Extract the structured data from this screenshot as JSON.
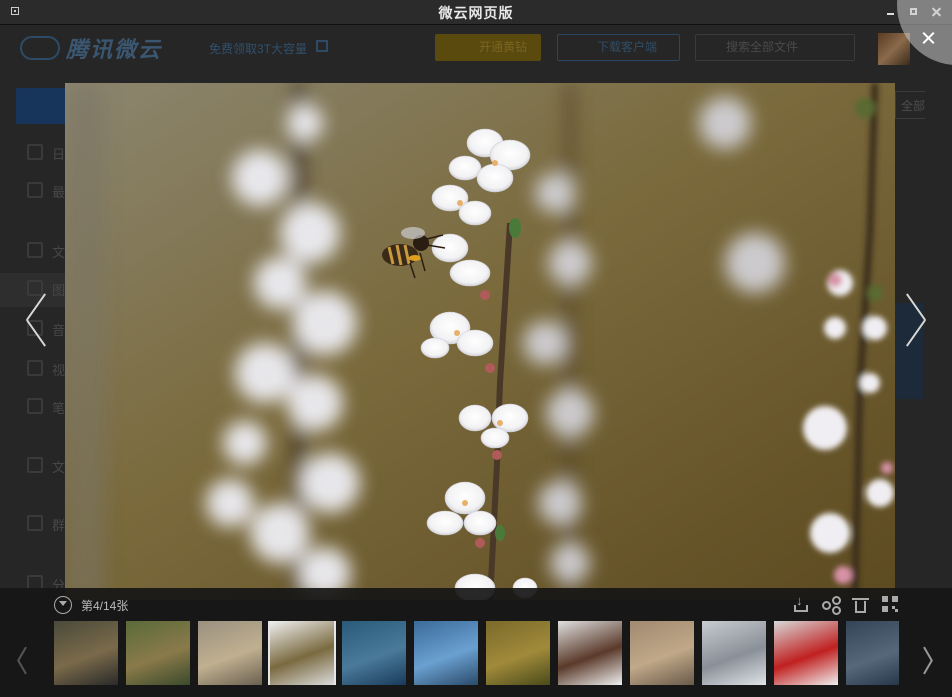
{
  "window": {
    "title": "微云网页版"
  },
  "background_app": {
    "logo_text": "腾讯微云",
    "promo": "免费领取3T大容量",
    "vip_button": "开通黄钻",
    "download_button": "下载客户端",
    "search_placeholder": "搜索全部文件",
    "all_filter": "全部",
    "sidebar_items": [
      {
        "label": "日",
        "icon": "doc-icon"
      },
      {
        "label": "最",
        "icon": "clock-icon"
      },
      {
        "label": "文",
        "icon": "file-icon"
      },
      {
        "label": "图",
        "icon": "image-icon"
      },
      {
        "label": "音",
        "icon": "music-icon"
      },
      {
        "label": "视",
        "icon": "video-icon"
      },
      {
        "label": "笔",
        "icon": "note-icon"
      },
      {
        "label": "文",
        "icon": "folder-icon"
      },
      {
        "label": "群",
        "icon": "group-icon"
      },
      {
        "label": "分",
        "icon": "share-icon"
      }
    ]
  },
  "viewer": {
    "counter": "第4/14张",
    "close_icon": "close-icon",
    "photo_subject": "bee-on-blossom-photo",
    "tools": [
      "download-icon",
      "share-icon",
      "delete-icon",
      "qrcode-icon"
    ],
    "thumbnails": [
      {
        "name": "thumb-1",
        "colors": [
          "#4a4a3a",
          "#7a6a4a",
          "#2a2a2a"
        ]
      },
      {
        "name": "thumb-2",
        "colors": [
          "#5a6a3a",
          "#8a7a4a",
          "#3a4a2a"
        ]
      },
      {
        "name": "thumb-3",
        "colors": [
          "#9a9080",
          "#c0b090",
          "#6a6050"
        ]
      },
      {
        "name": "thumb-4",
        "colors": [
          "#f0f0f0",
          "#7a6a40",
          "#dcdcdc"
        ],
        "active": true
      },
      {
        "name": "thumb-5",
        "colors": [
          "#2a5a7a",
          "#4a7a9a",
          "#1a3a5a"
        ]
      },
      {
        "name": "thumb-6",
        "colors": [
          "#3a6a9a",
          "#6aa0d0",
          "#2a4a6a"
        ]
      },
      {
        "name": "thumb-7",
        "colors": [
          "#7a6a2a",
          "#a08a3a",
          "#4a4a1a"
        ]
      },
      {
        "name": "thumb-8",
        "colors": [
          "#e0e0e0",
          "#5a3a2a",
          "#f0f0f0"
        ]
      },
      {
        "name": "thumb-9",
        "colors": [
          "#a08a70",
          "#c0a888",
          "#6a5a4a"
        ]
      },
      {
        "name": "thumb-10",
        "colors": [
          "#c8ccd0",
          "#8a9098",
          "#e0e4e8"
        ]
      },
      {
        "name": "thumb-11",
        "colors": [
          "#d8d8d8",
          "#c02020",
          "#f0f0f0"
        ]
      },
      {
        "name": "thumb-12",
        "colors": [
          "#4a6a8a",
          "#8aaacc",
          "#2a4a6a"
        ],
        "dim": true
      }
    ]
  }
}
